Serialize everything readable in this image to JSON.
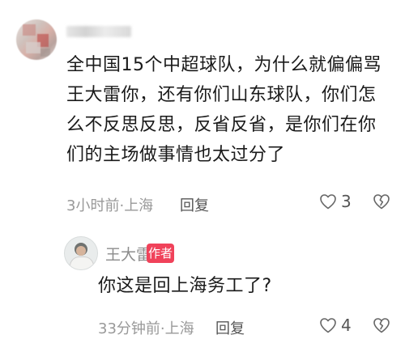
{
  "comment": {
    "text": "全中国15个中超球队，为什么就偏偏骂王大雷你，还有你们山东球队，你们怎么不反思反思，反省反省，是你们在你们的主场做事情也太过分了",
    "time": "3小时前",
    "location": "上海",
    "separator": "·",
    "reply_label": "回复",
    "likes": "3"
  },
  "reply": {
    "author_name": "王大雷",
    "author_badge": "作者",
    "text": "你这是回上海务工了?",
    "time": "33分钟前",
    "location": "上海",
    "separator": "·",
    "reply_label": "回复",
    "likes": "4"
  },
  "icons": {
    "like": "heart-outline-icon",
    "dislike": "broken-heart-outline-icon"
  },
  "colors": {
    "text": "#1a1a1a",
    "meta": "#999999",
    "author_badge_bg": "#f0425a"
  }
}
